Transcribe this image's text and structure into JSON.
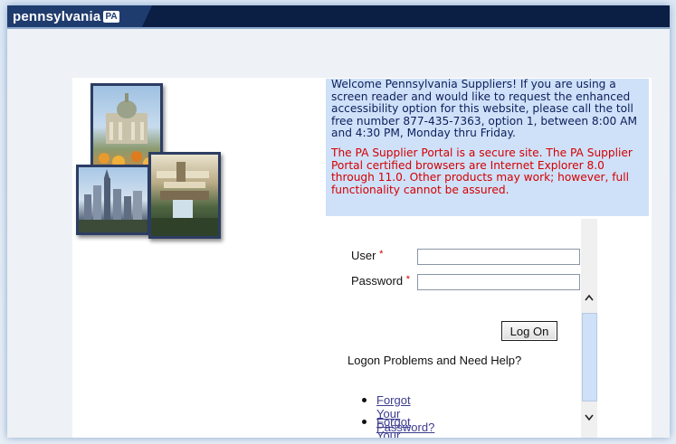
{
  "header": {
    "brand_text": "pennsylvania",
    "brand_badge": "PA"
  },
  "welcome": {
    "message": "Welcome Pennsylvania Suppliers! If you are using a screen reader and would like to request the enhanced accessibility option for this website, please call the toll free number 877-435-7363, option 1, between 8:00 AM and 4:30 PM, Monday thru Friday.",
    "security_notice": "The PA Supplier Portal is a secure site. The PA Supplier Portal certified browsers are Internet Explorer 8.0 through 11.0. Other products may work; however, full functionality cannot be assured."
  },
  "login": {
    "user_label": "User",
    "password_label": "Password",
    "required_marker": "*",
    "user_value": "",
    "password_value": "",
    "logon_button": "Log On",
    "help_heading": "Logon Problems and Need Help?",
    "links": [
      {
        "label": "Forgot Your Password?"
      },
      {
        "label": "Forgot Your UserID?"
      }
    ]
  },
  "scrollbar": {
    "up_icon": "chevron-up-icon",
    "down_icon": "chevron-down-icon"
  },
  "colors": {
    "header_bg": "#0b1f45",
    "welcome_bg": "#cfe1f9",
    "welcome_text": "#0c1f5a",
    "warning_text": "#d40000",
    "link_text": "#3d3d8f"
  }
}
